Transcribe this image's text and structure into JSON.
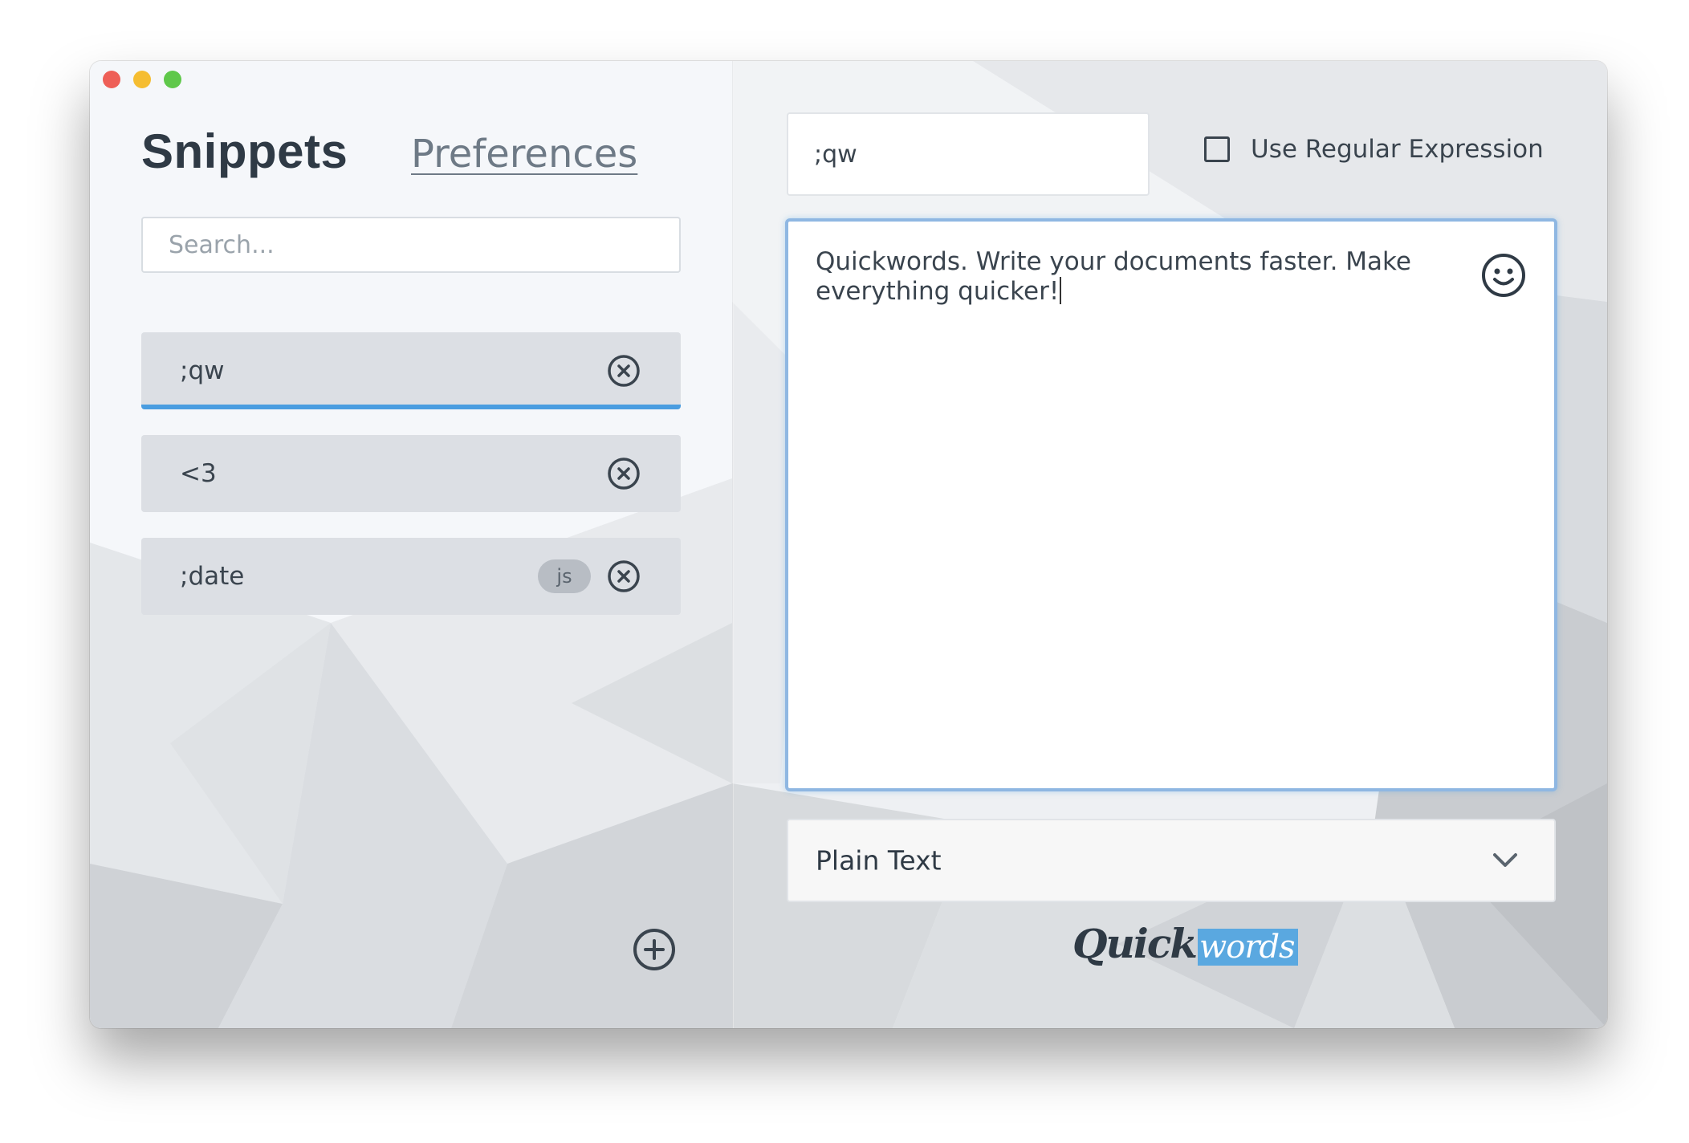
{
  "window": {
    "controls": [
      "close",
      "minimize",
      "zoom"
    ],
    "control_colors": [
      "#ee5f57",
      "#f5bd31",
      "#5fc84a"
    ]
  },
  "sidebar": {
    "title": "Snippets",
    "preferences_link": "Preferences",
    "search": {
      "placeholder": "Search...",
      "value": ""
    },
    "snippets": [
      {
        "label": ";qw",
        "active": true,
        "badge": ""
      },
      {
        "label": "<3",
        "active": false,
        "badge": ""
      },
      {
        "label": ";date",
        "active": false,
        "badge": "js"
      }
    ],
    "add_icon": "plus-circle-icon",
    "remove_icon": "close-circle-icon"
  },
  "editor": {
    "trigger_value": ";qw",
    "use_regex": {
      "label": "Use Regular Expression",
      "checked": false
    },
    "content": "Quickwords. Write your documents faster. Make everything quicker!",
    "emoji_icon": "smiley-icon",
    "format": {
      "selected": "Plain Text"
    }
  },
  "brand": {
    "logo_part1": "Quick",
    "logo_part2": "words",
    "accent": "#4a9de0"
  }
}
